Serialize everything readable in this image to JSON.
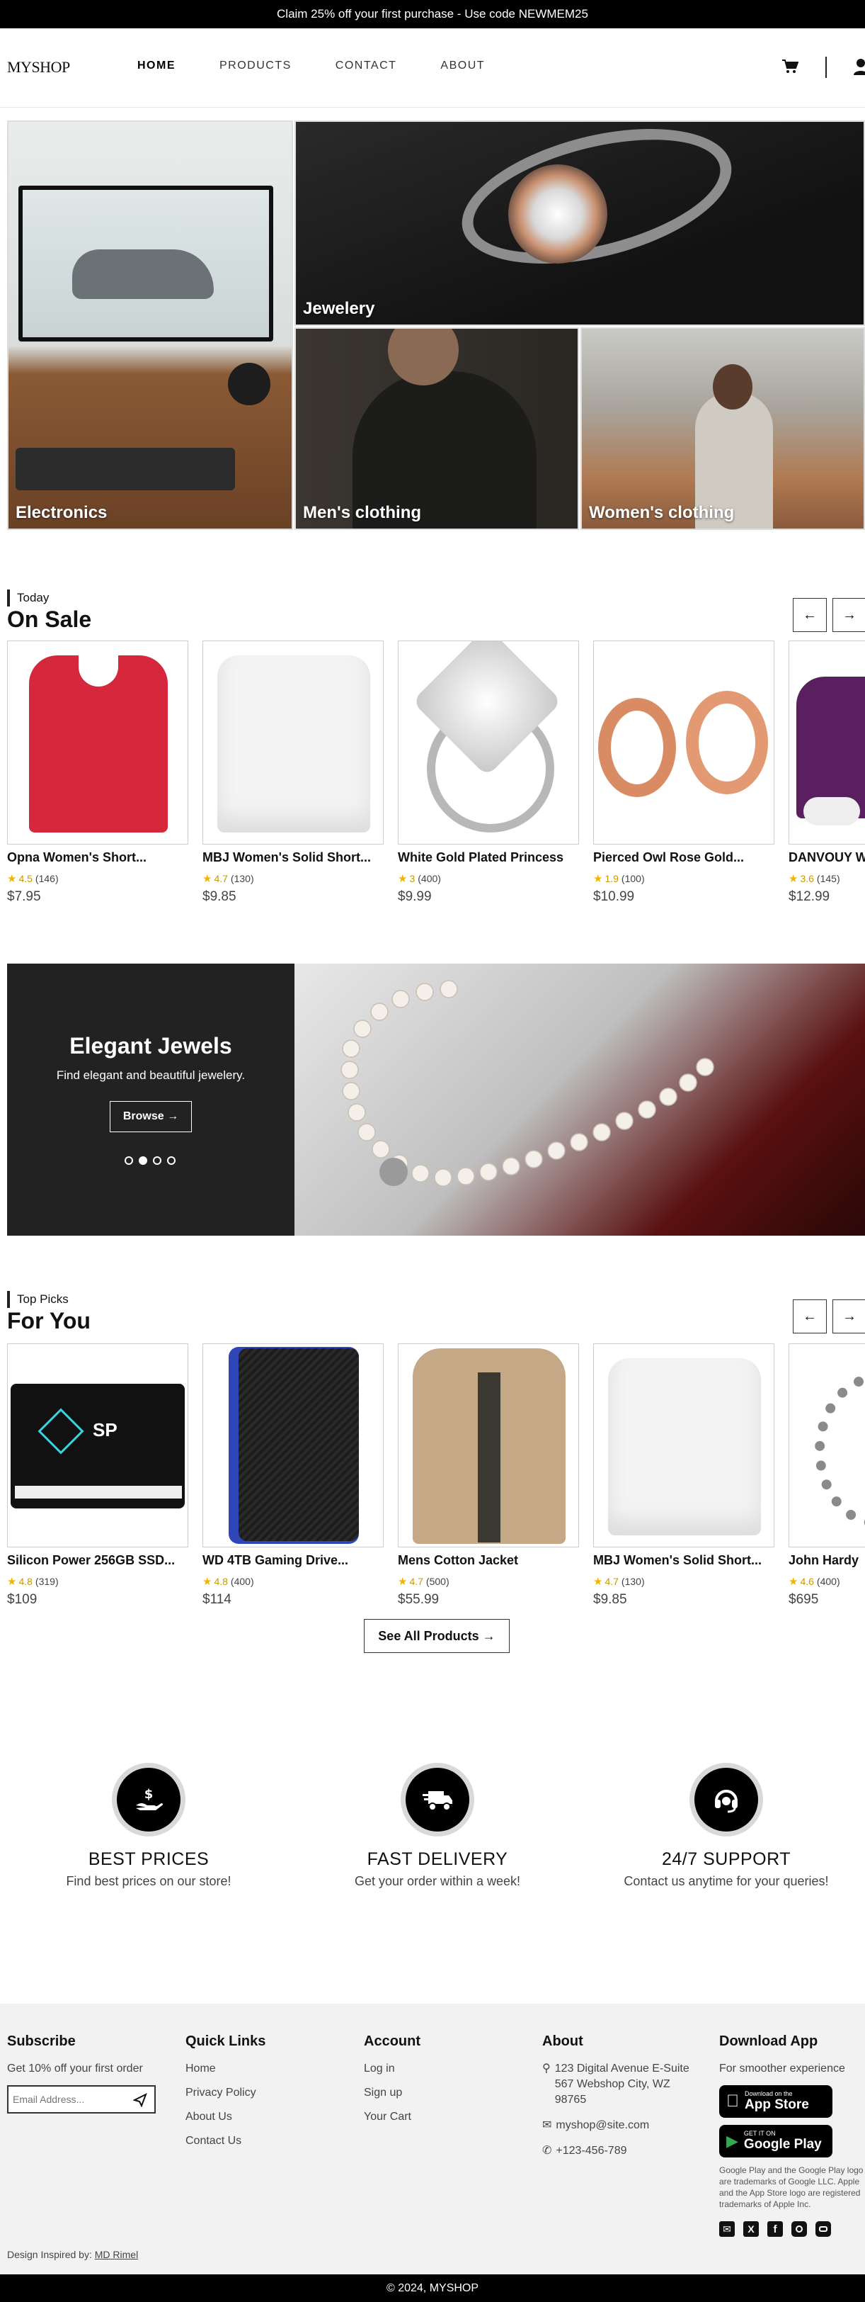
{
  "promo": "Claim 25% off your first purchase - Use code NEWMEM25",
  "brand": "MYSHOP",
  "nav": {
    "home": "HOME",
    "products": "PRODUCTS",
    "contact": "CONTACT",
    "about": "ABOUT"
  },
  "categories": {
    "electronics": "Electronics",
    "jewelery": "Jewelery",
    "mens": "Men's clothing",
    "womens": "Women's clothing"
  },
  "on_sale": {
    "label": "Today",
    "title": "On Sale",
    "products": [
      {
        "name": "Opna Women's Short...",
        "rating": "4.5",
        "count": "(146)",
        "price": "$7.95"
      },
      {
        "name": "MBJ Women's Solid Short...",
        "rating": "4.7",
        "count": "(130)",
        "price": "$9.85"
      },
      {
        "name": "White Gold Plated Princess",
        "rating": "3",
        "count": "(400)",
        "price": "$9.99"
      },
      {
        "name": "Pierced Owl Rose Gold...",
        "rating": "1.9",
        "count": "(100)",
        "price": "$10.99"
      },
      {
        "name": "DANVOUY W",
        "rating": "3.6",
        "count": "(145)",
        "price": "$12.99"
      }
    ]
  },
  "banner": {
    "title": "Elegant Jewels",
    "subtitle": "Find elegant and beautiful jewelery.",
    "button": "Browse"
  },
  "for_you": {
    "label": "Top Picks",
    "title": "For You",
    "products": [
      {
        "name": "Silicon Power 256GB SSD...",
        "rating": "4.8",
        "count": "(319)",
        "price": "$109"
      },
      {
        "name": "WD 4TB Gaming Drive...",
        "rating": "4.8",
        "count": "(400)",
        "price": "$114"
      },
      {
        "name": "Mens Cotton Jacket",
        "rating": "4.7",
        "count": "(500)",
        "price": "$55.99"
      },
      {
        "name": "MBJ Women's Solid Short...",
        "rating": "4.7",
        "count": "(130)",
        "price": "$9.85"
      },
      {
        "name": "John Hardy",
        "rating": "4.6",
        "count": "(400)",
        "price": "$695"
      }
    ],
    "see_all": "See All Products"
  },
  "features": [
    {
      "title": "BEST PRICES",
      "desc": "Find best prices on our store!",
      "icon": "hand-dollar-icon"
    },
    {
      "title": "FAST DELIVERY",
      "desc": "Get your order within a week!",
      "icon": "truck-icon"
    },
    {
      "title": "24/7 SUPPORT",
      "desc": "Contact us anytime for your queries!",
      "icon": "headset-icon"
    }
  ],
  "footer": {
    "subscribe": {
      "title": "Subscribe",
      "desc": "Get 10% off your first order",
      "placeholder": "Email Address..."
    },
    "quick": {
      "title": "Quick Links",
      "links": [
        "Home",
        "Privacy Policy",
        "About Us",
        "Contact Us"
      ]
    },
    "account": {
      "title": "Account",
      "links": [
        "Log in",
        "Sign up",
        "Your Cart"
      ]
    },
    "about": {
      "title": "About",
      "address": "123 Digital Avenue E-Suite 567 Webshop City, WZ 98765",
      "email": "myshop@site.com",
      "phone": "+123-456-789"
    },
    "app": {
      "title": "Download App",
      "desc": "For smoother experience",
      "appstore_small": "Download on the",
      "appstore": "App Store",
      "gplay_small": "GET IT ON",
      "gplay": "Google Play",
      "legal": "Google Play and the Google Play logo are trademarks of Google LLC. Apple and the App Store logo are registered trademarks of Apple Inc."
    },
    "credit_prefix": "Design Inspired by:",
    "credit_name": "MD Rimel"
  },
  "copyright": "© 2024, MYSHOP",
  "colors": {
    "accent": "#000000",
    "star": "#f3b400",
    "footer_bg": "#f2f2f2"
  }
}
